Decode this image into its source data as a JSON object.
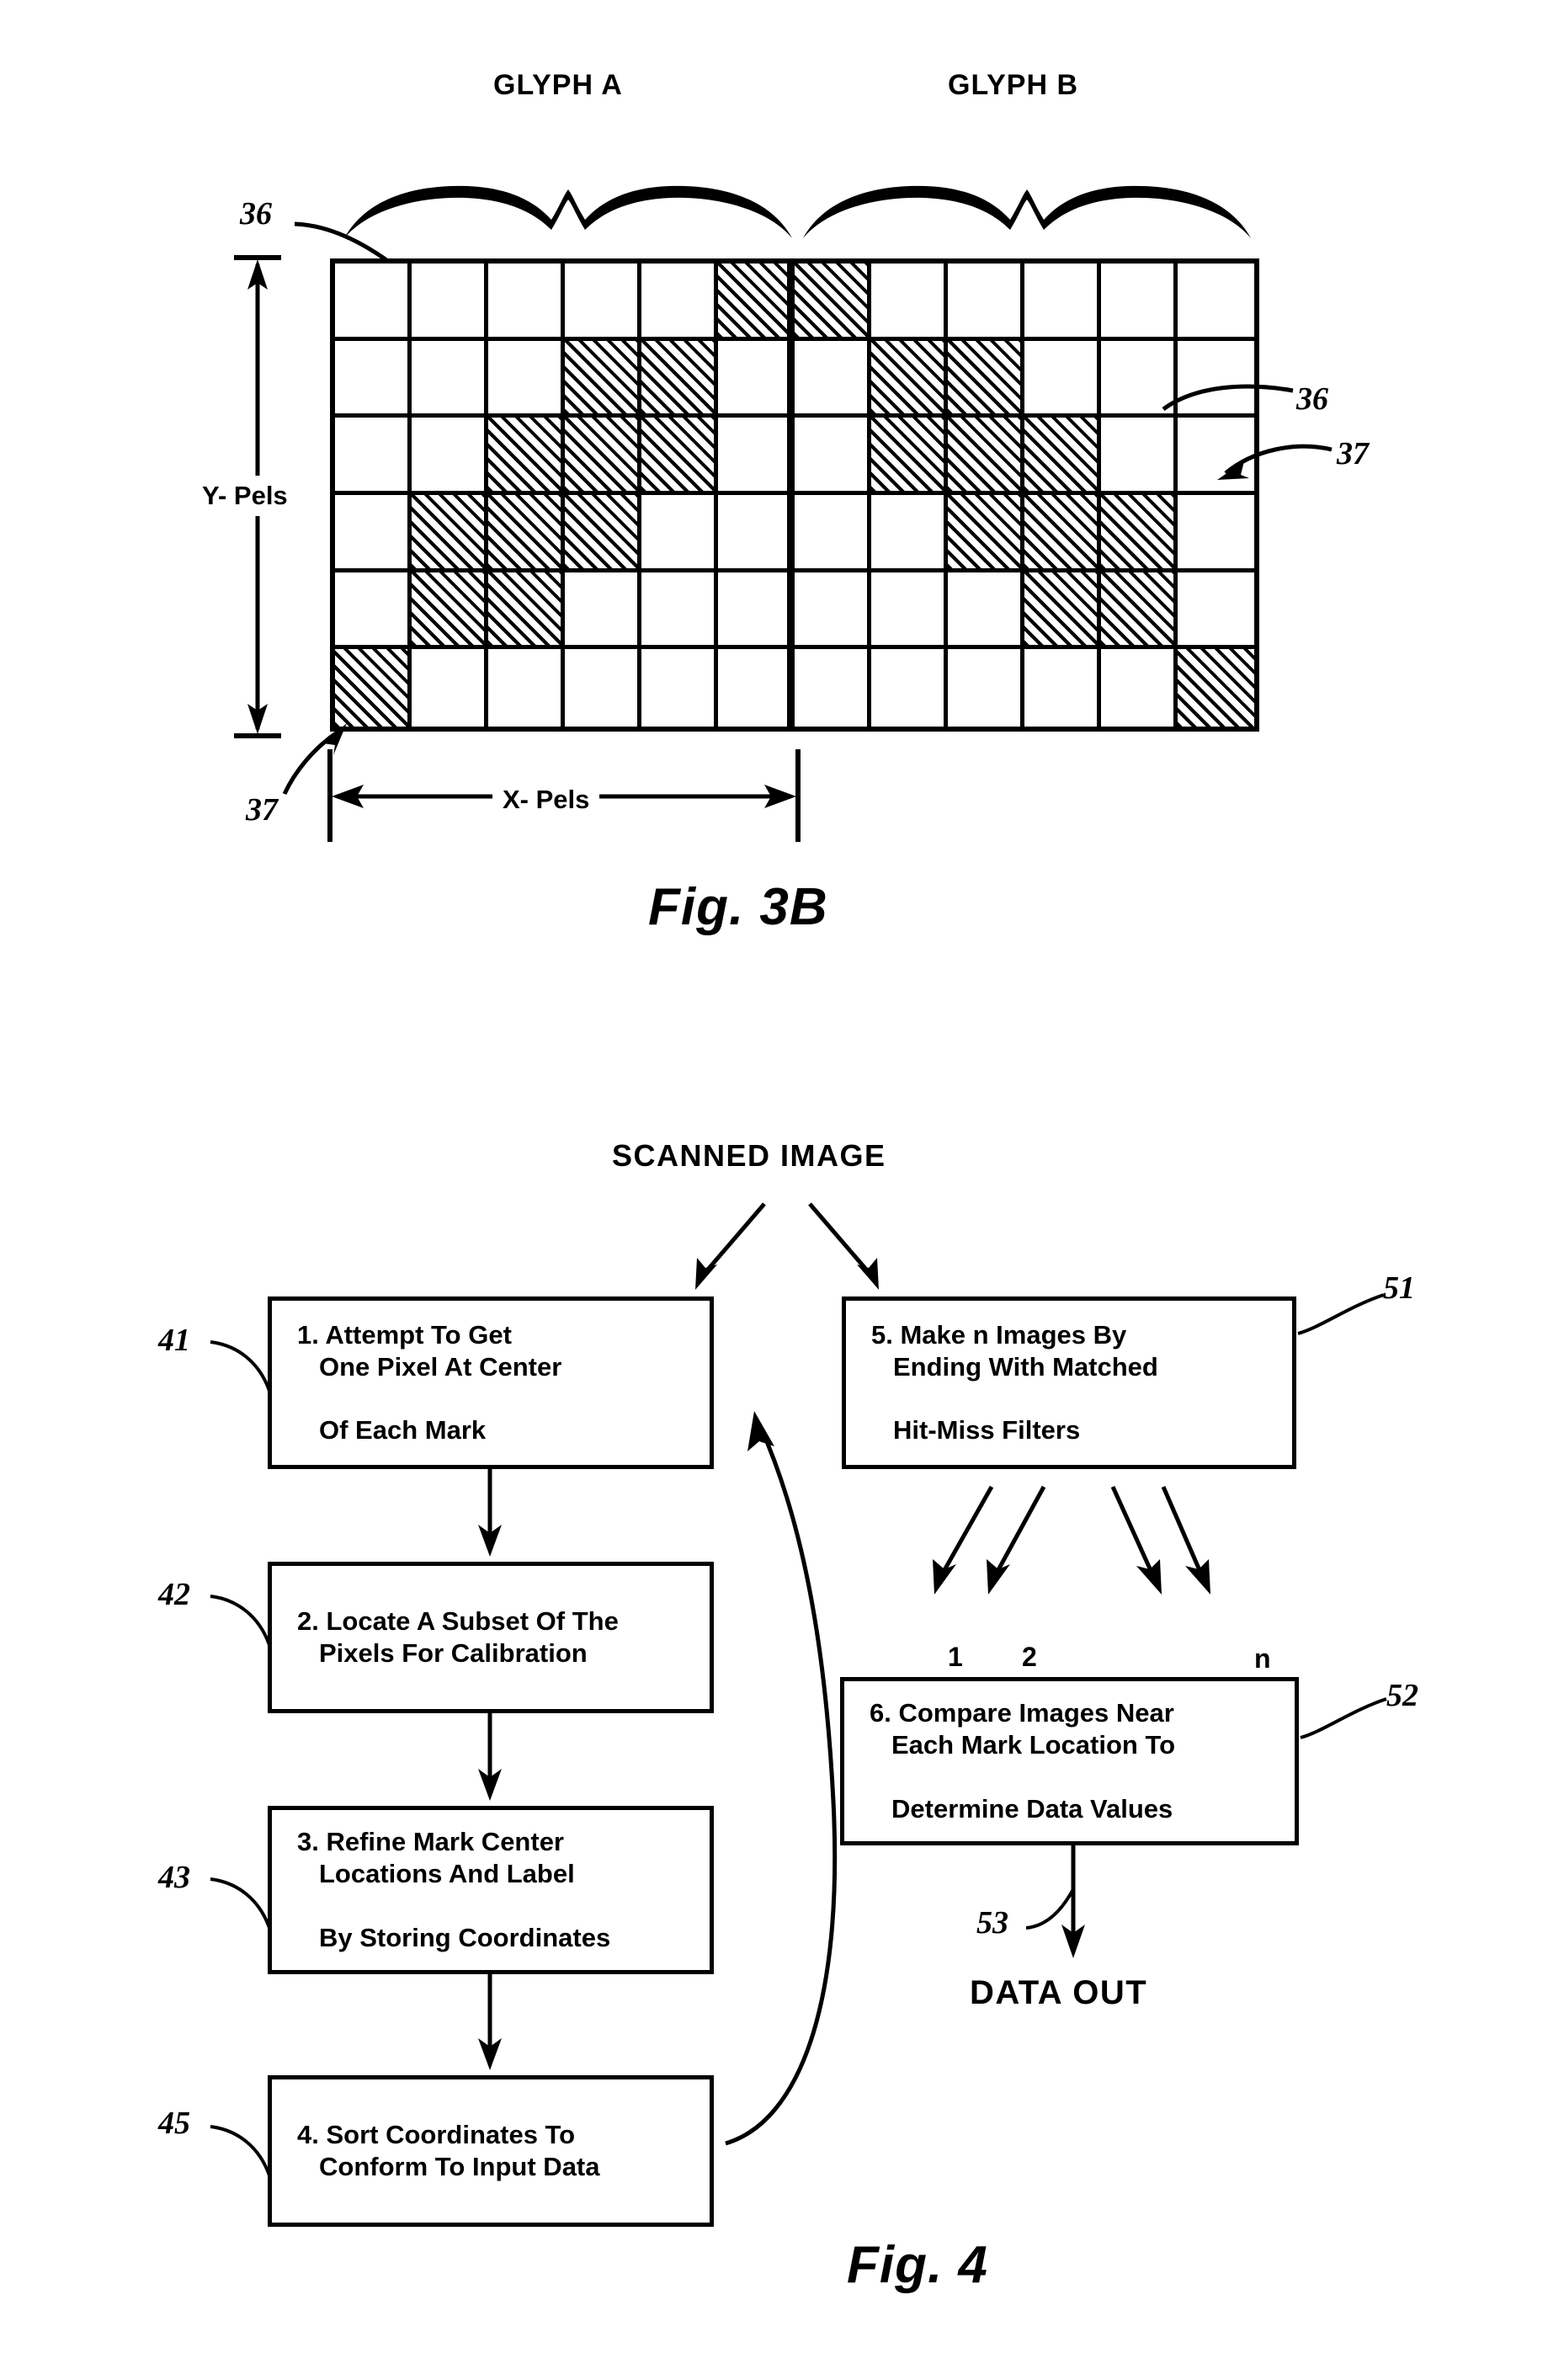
{
  "figure_3b": {
    "glyph_a_label": "GLYPH A",
    "glyph_b_label": "GLYPH B",
    "y_axis_label": "Y- Pels",
    "x_axis_label": "X- Pels",
    "caption": "Fig. 3B",
    "reference_numerals": {
      "top_left": "36",
      "right_upper": "36",
      "right_lower": "37",
      "bottom_left": "37"
    },
    "grid": {
      "columns": 12,
      "rows": 6,
      "glyph_separator_after_column": 6,
      "cells": [
        [
          0,
          0,
          0,
          0,
          0,
          1,
          1,
          0,
          0,
          0,
          0,
          0
        ],
        [
          0,
          0,
          0,
          1,
          1,
          0,
          0,
          1,
          1,
          0,
          0,
          0
        ],
        [
          0,
          0,
          1,
          1,
          1,
          0,
          0,
          1,
          1,
          1,
          0,
          0
        ],
        [
          0,
          1,
          1,
          1,
          0,
          0,
          0,
          0,
          1,
          1,
          1,
          0
        ],
        [
          0,
          1,
          1,
          0,
          0,
          0,
          0,
          0,
          0,
          1,
          1,
          0
        ],
        [
          1,
          0,
          0,
          0,
          0,
          0,
          0,
          0,
          0,
          0,
          0,
          1
        ]
      ]
    }
  },
  "figure_4": {
    "caption": "Fig. 4",
    "input_label": "SCANNED IMAGE",
    "output_label": "DATA OUT",
    "branch_labels": [
      "1",
      "2",
      "n"
    ],
    "boxes": [
      {
        "ref": "41",
        "line1": "1. Attempt To Get",
        "line2": "One Pixel At Center",
        "line3": "Of Each Mark"
      },
      {
        "ref": "42",
        "line1": "2. Locate A Subset Of The",
        "line2": "Pixels For Calibration",
        "line3": ""
      },
      {
        "ref": "43",
        "line1": "3. Refine Mark Center",
        "line2": "Locations And Label",
        "line3": "By Storing Coordinates"
      },
      {
        "ref": "45",
        "line1": "4. Sort Coordinates To",
        "line2": "Conform To Input Data",
        "line3": ""
      },
      {
        "ref": "51",
        "line1": "5. Make n Images By",
        "line2": "Ending With Matched",
        "line3": "Hit-Miss Filters"
      },
      {
        "ref": "52",
        "line1": "6. Compare Images Near",
        "line2": "Each Mark Location To",
        "line3": "Determine Data Values"
      }
    ],
    "output_arrow_ref": "53"
  },
  "colors": {
    "ink": "#000000",
    "paper": "#ffffff"
  }
}
